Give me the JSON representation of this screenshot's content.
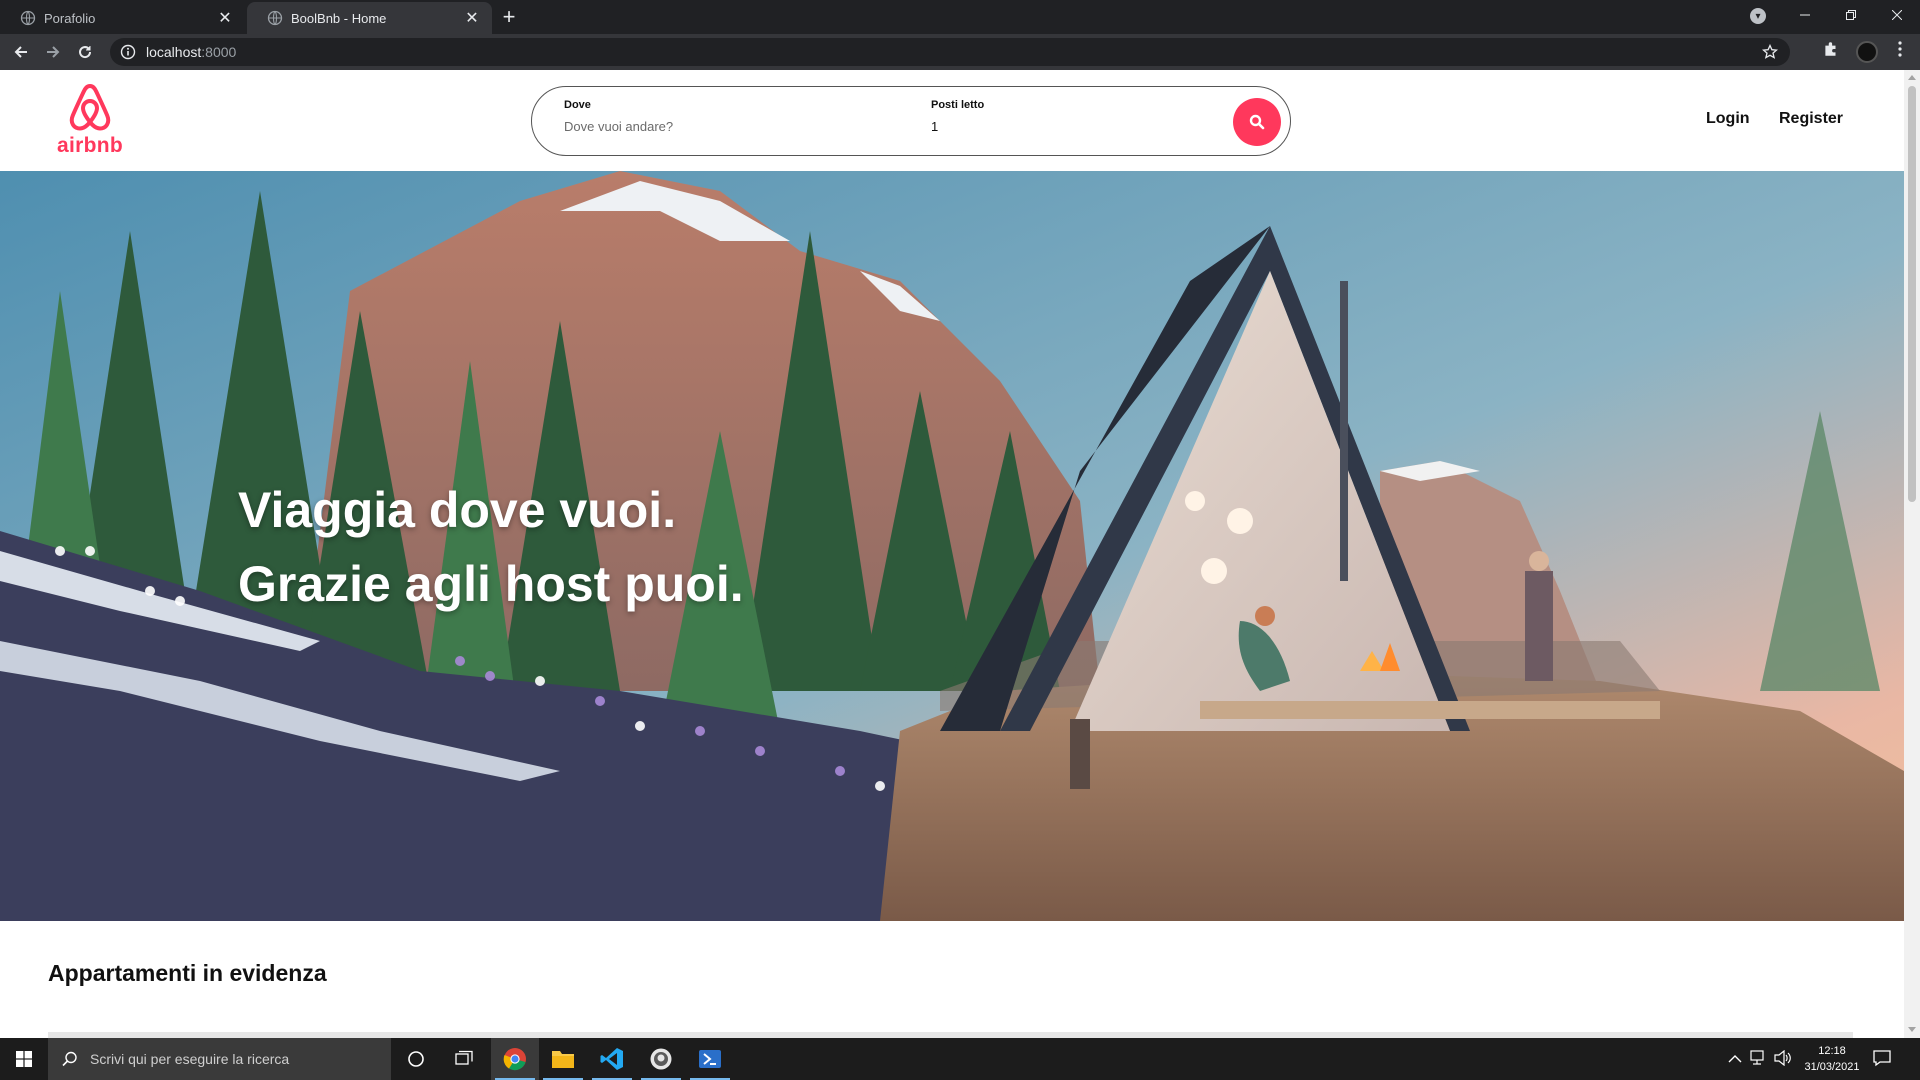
{
  "browser": {
    "tabs": [
      {
        "title": "Porafolio",
        "active": false
      },
      {
        "title": "BoolBnb - Home",
        "active": true
      }
    ],
    "address": {
      "host": "localhost",
      "port": ":8000"
    }
  },
  "site": {
    "logo_text": "airbnb",
    "search": {
      "where_label": "Dove",
      "where_placeholder": "Dove vuoi andare?",
      "beds_label": "Posti letto",
      "beds_value": "1"
    },
    "nav": {
      "login": "Login",
      "register": "Register"
    },
    "hero": {
      "line1": "Viaggia dove vuoi.",
      "line2": "Grazie agli host puoi."
    },
    "featured_title": "Appartamenti in evidenza"
  },
  "taskbar": {
    "search_placeholder": "Scrivi qui per eseguire la ricerca",
    "time": "12:18",
    "date": "31/03/2021"
  },
  "colors": {
    "brand": "#ff385c",
    "chrome_dark": "#202124",
    "chrome_mid": "#35363a"
  }
}
